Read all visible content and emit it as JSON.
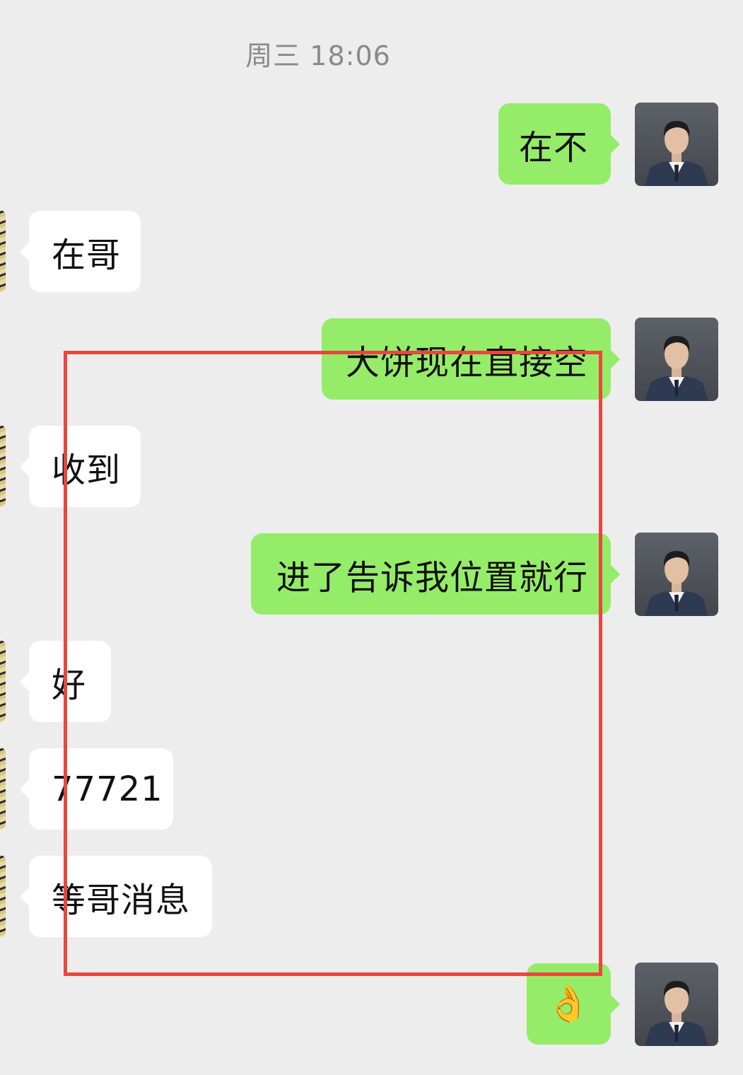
{
  "chat": {
    "timestamp": "周三 18:06",
    "messages": [
      {
        "sender": "self",
        "text": "在不"
      },
      {
        "sender": "other",
        "text": "在哥"
      },
      {
        "sender": "self",
        "text": "大饼现在直接空"
      },
      {
        "sender": "other",
        "text": "收到"
      },
      {
        "sender": "self",
        "text": "进了告诉我位置就行"
      },
      {
        "sender": "other",
        "text": "好"
      },
      {
        "sender": "other",
        "text": "77721"
      },
      {
        "sender": "other",
        "text": "等哥消息"
      },
      {
        "sender": "self",
        "text": "👌"
      }
    ]
  },
  "colors": {
    "background": "#EDEDED",
    "outgoing_bubble": "#95EC69",
    "incoming_bubble": "#FFFFFF",
    "highlight_border": "#E8473C",
    "timestamp_text": "#8a8a8a"
  },
  "icons": {
    "self_avatar": "man-in-suit-avatar",
    "other_avatar": "contact-avatar-partial"
  }
}
